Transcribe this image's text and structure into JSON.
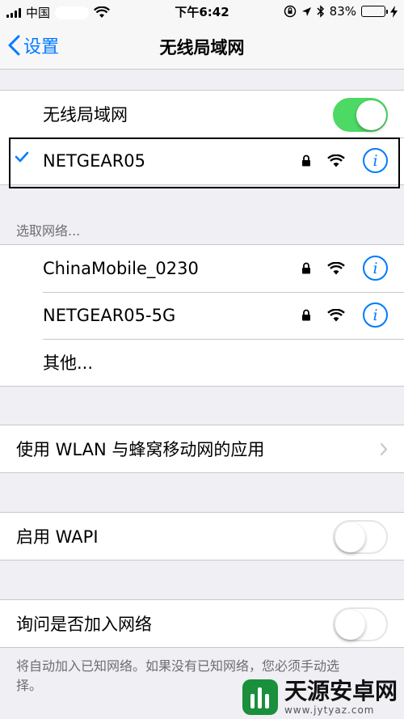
{
  "status_bar": {
    "carrier": "中国",
    "time": "下午6:42",
    "battery_percent": "83%",
    "battery_level": 0.83
  },
  "nav": {
    "back_label": "设置",
    "title": "无线局域网"
  },
  "wifi_toggle": {
    "label": "无线局域网",
    "on": true
  },
  "connected_network": {
    "name": "NETGEAR05",
    "secured": true
  },
  "section_header": "选取网络...",
  "networks": [
    {
      "name": "ChinaMobile_0230",
      "secured": true
    },
    {
      "name": "NETGEAR05-5G",
      "secured": true
    }
  ],
  "other_label": "其他...",
  "wlan_apps_label": "使用 WLAN 与蜂窝移动网的应用",
  "wapi": {
    "label": "启用 WAPI",
    "on": false
  },
  "ask_join": {
    "label": "询问是否加入网络",
    "on": false,
    "footer": "将自动加入已知网络。如果没有已知网络，您必须手动选择。"
  },
  "watermark": {
    "title": "天源安卓网",
    "url": "www.jytyaz.com"
  },
  "colors": {
    "accent": "#007aff",
    "toggle_on": "#4cd964"
  }
}
